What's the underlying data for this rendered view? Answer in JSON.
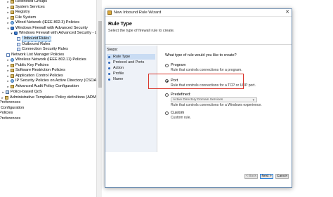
{
  "tree": {
    "items": [
      {
        "label": "Restricted Groups",
        "exp": "▸",
        "icon": "folder-icon"
      },
      {
        "label": "System Services",
        "exp": "▸",
        "icon": "folder-icon"
      },
      {
        "label": "Registry",
        "exp": "▸",
        "icon": "folder-icon"
      },
      {
        "label": "File System",
        "exp": "▸",
        "icon": "folder-icon"
      },
      {
        "label": "Wired Network (IEEE 802.3) Policies",
        "exp": "▸",
        "icon": "network-icon"
      },
      {
        "label": "Windows Firewall with Advanced Security",
        "exp": "▾",
        "icon": "firewall-icon"
      },
      {
        "label": "Windows Firewall with Advanced Security - LD",
        "exp": "▾",
        "icon": "firewall-icon"
      },
      {
        "label": "Inbound Rules",
        "exp": "",
        "icon": "rules-icon",
        "selected": true
      },
      {
        "label": "Outbound Rules",
        "exp": "",
        "icon": "rules-icon"
      },
      {
        "label": "Connection Security Rules",
        "exp": "",
        "icon": "rules-icon"
      },
      {
        "label": "Network List Manager Policies",
        "exp": "",
        "icon": "list-icon"
      },
      {
        "label": "Wireless Network (IEEE 802.11) Policies",
        "exp": "▸",
        "icon": "network-icon"
      },
      {
        "label": "Public Key Policies",
        "exp": "▸",
        "icon": "folder-icon"
      },
      {
        "label": "Software Restriction Policies",
        "exp": "▸",
        "icon": "folder-icon"
      },
      {
        "label": "Application Control Policies",
        "exp": "▸",
        "icon": "folder-icon"
      },
      {
        "label": "IP Security Policies on Active Directory (CSOAR.LC",
        "exp": "▸",
        "icon": "network-icon"
      },
      {
        "label": "Advanced Audit Policy Configuration",
        "exp": "▸",
        "icon": "folder-icon"
      },
      {
        "label": "Policy-based QoS",
        "exp": "▸",
        "icon": "chart-icon"
      },
      {
        "label": "Administrative Templates: Policy definitions (ADMX files)",
        "exp": "▸",
        "icon": "folder-icon"
      },
      {
        "label": "Preferences",
        "exp": "",
        "icon": ""
      },
      {
        "label": "Configuration",
        "exp": "",
        "icon": ""
      },
      {
        "label": "Policies",
        "exp": "",
        "icon": ""
      },
      {
        "label": "Preferences",
        "exp": "",
        "icon": ""
      }
    ]
  },
  "dialog": {
    "title": "New Inbound Rule Wizard",
    "header_title": "Rule Type",
    "header_subtitle": "Select the type of firewall rule to create.",
    "steps_title": "Steps:",
    "steps": [
      "Rule Type",
      "Protocol and Ports",
      "Action",
      "Profile",
      "Name"
    ],
    "current_step": 0,
    "question": "What type of rule would you like to create?",
    "options": [
      {
        "label": "Program",
        "desc": "Rule that controls connections for a program.",
        "selected": false
      },
      {
        "label": "Port",
        "desc": "Rule that controls connections for a TCP or UDP port.",
        "selected": true
      },
      {
        "label": "Predefined:",
        "desc": "Rule that controls connections for a Windows experience.",
        "selected": false,
        "dropdown": "Active Directory Domain Services"
      },
      {
        "label": "Custom",
        "desc": "Custom rule.",
        "selected": false
      }
    ],
    "buttons": {
      "back": "< Back",
      "next": "Next >",
      "cancel": "Cancel"
    },
    "highlight_color": "#d9342b"
  }
}
